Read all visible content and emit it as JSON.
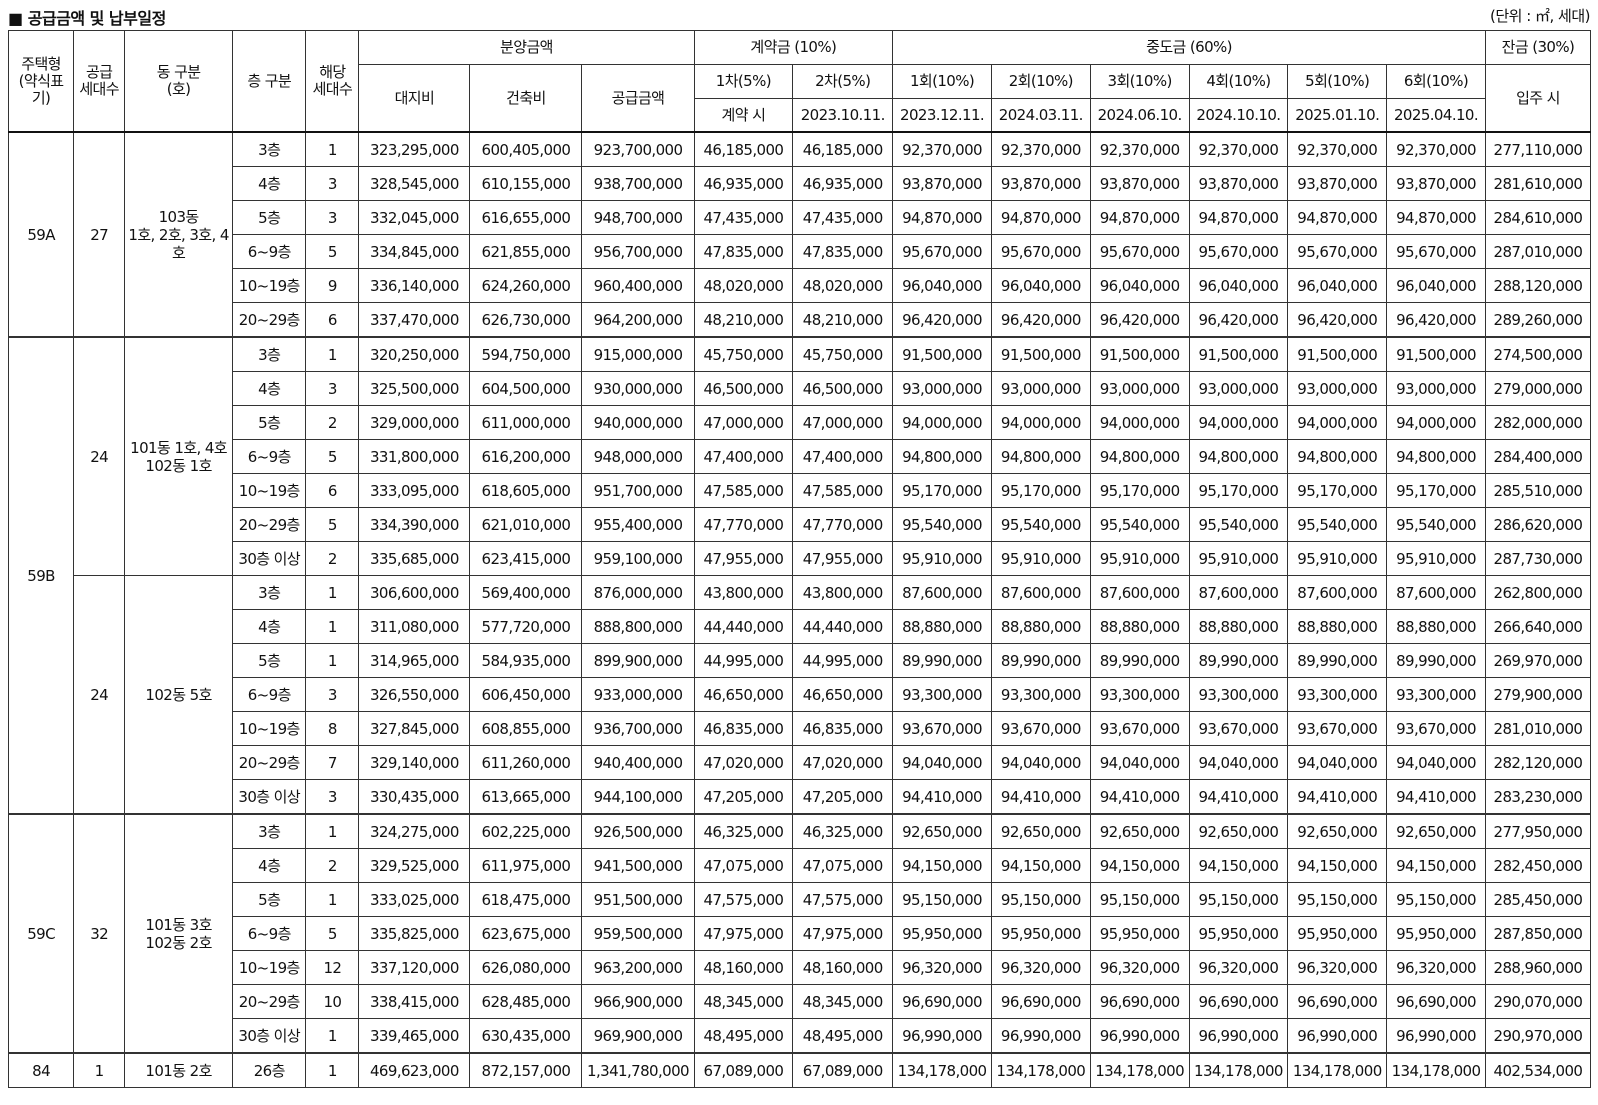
{
  "title": "■ 공급금액 및 납부일정",
  "unit": "(단위 : ㎡, 세대)",
  "headers": {
    "type": [
      "주택형",
      "(약식표",
      "기)"
    ],
    "supply": [
      "공급",
      "세대수"
    ],
    "dong": [
      "동 구분",
      "(호)"
    ],
    "floor": "층 구분",
    "units": [
      "해당",
      "세대수"
    ],
    "price_group": "분양금액",
    "land": "대지비",
    "build": "건축비",
    "supply_price": "공급금액",
    "contract_group": "계약금 (10%)",
    "c1": "1차(5%)",
    "c2": "2차(5%)",
    "c1_when": "계약 시",
    "c2_when": "2023.10.11.",
    "mid_group": "중도금 (60%)",
    "m_labels": [
      "1회(10%)",
      "2회(10%)",
      "3회(10%)",
      "4회(10%)",
      "5회(10%)",
      "6회(10%)"
    ],
    "m_dates": [
      "2023.12.11.",
      "2024.03.11.",
      "2024.06.10.",
      "2024.10.10.",
      "2025.01.10.",
      "2025.04.10."
    ],
    "balance_group": "잔금 (30%)",
    "balance_when": "입주 시"
  },
  "groups": [
    {
      "type": "59A",
      "subs": [
        {
          "supply": "27",
          "dong": [
            "103동",
            "1호, 2호, 3호, 4호"
          ],
          "rows": [
            {
              "floor": "3층",
              "units": "1",
              "land": "323,295,000",
              "build": "600,405,000",
              "supply": "923,700,000",
              "c1": "46,185,000",
              "c2": "46,185,000",
              "m": "92,370,000",
              "bal": "277,110,000"
            },
            {
              "floor": "4층",
              "units": "3",
              "land": "328,545,000",
              "build": "610,155,000",
              "supply": "938,700,000",
              "c1": "46,935,000",
              "c2": "46,935,000",
              "m": "93,870,000",
              "bal": "281,610,000"
            },
            {
              "floor": "5층",
              "units": "3",
              "land": "332,045,000",
              "build": "616,655,000",
              "supply": "948,700,000",
              "c1": "47,435,000",
              "c2": "47,435,000",
              "m": "94,870,000",
              "bal": "284,610,000"
            },
            {
              "floor": "6~9층",
              "units": "5",
              "land": "334,845,000",
              "build": "621,855,000",
              "supply": "956,700,000",
              "c1": "47,835,000",
              "c2": "47,835,000",
              "m": "95,670,000",
              "bal": "287,010,000"
            },
            {
              "floor": "10~19층",
              "units": "9",
              "land": "336,140,000",
              "build": "624,260,000",
              "supply": "960,400,000",
              "c1": "48,020,000",
              "c2": "48,020,000",
              "m": "96,040,000",
              "bal": "288,120,000"
            },
            {
              "floor": "20~29층",
              "units": "6",
              "land": "337,470,000",
              "build": "626,730,000",
              "supply": "964,200,000",
              "c1": "48,210,000",
              "c2": "48,210,000",
              "m": "96,420,000",
              "bal": "289,260,000"
            }
          ]
        }
      ]
    },
    {
      "type": "59B",
      "subs": [
        {
          "supply": "24",
          "dong": [
            "101동 1호, 4호",
            "102동 1호"
          ],
          "rows": [
            {
              "floor": "3층",
              "units": "1",
              "land": "320,250,000",
              "build": "594,750,000",
              "supply": "915,000,000",
              "c1": "45,750,000",
              "c2": "45,750,000",
              "m": "91,500,000",
              "bal": "274,500,000"
            },
            {
              "floor": "4층",
              "units": "3",
              "land": "325,500,000",
              "build": "604,500,000",
              "supply": "930,000,000",
              "c1": "46,500,000",
              "c2": "46,500,000",
              "m": "93,000,000",
              "bal": "279,000,000"
            },
            {
              "floor": "5층",
              "units": "2",
              "land": "329,000,000",
              "build": "611,000,000",
              "supply": "940,000,000",
              "c1": "47,000,000",
              "c2": "47,000,000",
              "m": "94,000,000",
              "bal": "282,000,000"
            },
            {
              "floor": "6~9층",
              "units": "5",
              "land": "331,800,000",
              "build": "616,200,000",
              "supply": "948,000,000",
              "c1": "47,400,000",
              "c2": "47,400,000",
              "m": "94,800,000",
              "bal": "284,400,000"
            },
            {
              "floor": "10~19층",
              "units": "6",
              "land": "333,095,000",
              "build": "618,605,000",
              "supply": "951,700,000",
              "c1": "47,585,000",
              "c2": "47,585,000",
              "m": "95,170,000",
              "bal": "285,510,000"
            },
            {
              "floor": "20~29층",
              "units": "5",
              "land": "334,390,000",
              "build": "621,010,000",
              "supply": "955,400,000",
              "c1": "47,770,000",
              "c2": "47,770,000",
              "m": "95,540,000",
              "bal": "286,620,000"
            },
            {
              "floor": "30층 이상",
              "units": "2",
              "land": "335,685,000",
              "build": "623,415,000",
              "supply": "959,100,000",
              "c1": "47,955,000",
              "c2": "47,955,000",
              "m": "95,910,000",
              "bal": "287,730,000"
            }
          ]
        },
        {
          "supply": "24",
          "dong": [
            "102동 5호"
          ],
          "rows": [
            {
              "floor": "3층",
              "units": "1",
              "land": "306,600,000",
              "build": "569,400,000",
              "supply": "876,000,000",
              "c1": "43,800,000",
              "c2": "43,800,000",
              "m": "87,600,000",
              "bal": "262,800,000"
            },
            {
              "floor": "4층",
              "units": "1",
              "land": "311,080,000",
              "build": "577,720,000",
              "supply": "888,800,000",
              "c1": "44,440,000",
              "c2": "44,440,000",
              "m": "88,880,000",
              "bal": "266,640,000"
            },
            {
              "floor": "5층",
              "units": "1",
              "land": "314,965,000",
              "build": "584,935,000",
              "supply": "899,900,000",
              "c1": "44,995,000",
              "c2": "44,995,000",
              "m": "89,990,000",
              "bal": "269,970,000"
            },
            {
              "floor": "6~9층",
              "units": "3",
              "land": "326,550,000",
              "build": "606,450,000",
              "supply": "933,000,000",
              "c1": "46,650,000",
              "c2": "46,650,000",
              "m": "93,300,000",
              "bal": "279,900,000"
            },
            {
              "floor": "10~19층",
              "units": "8",
              "land": "327,845,000",
              "build": "608,855,000",
              "supply": "936,700,000",
              "c1": "46,835,000",
              "c2": "46,835,000",
              "m": "93,670,000",
              "bal": "281,010,000"
            },
            {
              "floor": "20~29층",
              "units": "7",
              "land": "329,140,000",
              "build": "611,260,000",
              "supply": "940,400,000",
              "c1": "47,020,000",
              "c2": "47,020,000",
              "m": "94,040,000",
              "bal": "282,120,000"
            },
            {
              "floor": "30층 이상",
              "units": "3",
              "land": "330,435,000",
              "build": "613,665,000",
              "supply": "944,100,000",
              "c1": "47,205,000",
              "c2": "47,205,000",
              "m": "94,410,000",
              "bal": "283,230,000"
            }
          ]
        }
      ]
    },
    {
      "type": "59C",
      "subs": [
        {
          "supply": "32",
          "dong": [
            "101동 3호",
            "102동 2호"
          ],
          "rows": [
            {
              "floor": "3층",
              "units": "1",
              "land": "324,275,000",
              "build": "602,225,000",
              "supply": "926,500,000",
              "c1": "46,325,000",
              "c2": "46,325,000",
              "m": "92,650,000",
              "bal": "277,950,000"
            },
            {
              "floor": "4층",
              "units": "2",
              "land": "329,525,000",
              "build": "611,975,000",
              "supply": "941,500,000",
              "c1": "47,075,000",
              "c2": "47,075,000",
              "m": "94,150,000",
              "bal": "282,450,000"
            },
            {
              "floor": "5층",
              "units": "1",
              "land": "333,025,000",
              "build": "618,475,000",
              "supply": "951,500,000",
              "c1": "47,575,000",
              "c2": "47,575,000",
              "m": "95,150,000",
              "bal": "285,450,000"
            },
            {
              "floor": "6~9층",
              "units": "5",
              "land": "335,825,000",
              "build": "623,675,000",
              "supply": "959,500,000",
              "c1": "47,975,000",
              "c2": "47,975,000",
              "m": "95,950,000",
              "bal": "287,850,000"
            },
            {
              "floor": "10~19층",
              "units": "12",
              "land": "337,120,000",
              "build": "626,080,000",
              "supply": "963,200,000",
              "c1": "48,160,000",
              "c2": "48,160,000",
              "m": "96,320,000",
              "bal": "288,960,000"
            },
            {
              "floor": "20~29층",
              "units": "10",
              "land": "338,415,000",
              "build": "628,485,000",
              "supply": "966,900,000",
              "c1": "48,345,000",
              "c2": "48,345,000",
              "m": "96,690,000",
              "bal": "290,070,000"
            },
            {
              "floor": "30층 이상",
              "units": "1",
              "land": "339,465,000",
              "build": "630,435,000",
              "supply": "969,900,000",
              "c1": "48,495,000",
              "c2": "48,495,000",
              "m": "96,990,000",
              "bal": "290,970,000"
            }
          ]
        }
      ]
    },
    {
      "type": "84",
      "subs": [
        {
          "supply": "1",
          "dong": [
            "101동 2호"
          ],
          "rows": [
            {
              "floor": "26층",
              "units": "1",
              "land": "469,623,000",
              "build": "872,157,000",
              "supply": "1,341,780,000",
              "c1": "67,089,000",
              "c2": "67,089,000",
              "m": "134,178,000",
              "bal": "402,534,000"
            }
          ]
        }
      ]
    }
  ]
}
